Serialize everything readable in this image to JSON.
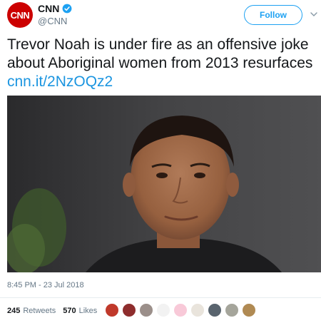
{
  "author": {
    "avatar_text": "CNN",
    "name": "CNN",
    "handle": "@CNN",
    "verified_color": "#1da1f2"
  },
  "actions": {
    "follow_label": "Follow"
  },
  "tweet": {
    "text": "Trevor Noah is under fire as an offensive joke about Aboriginal women from 2013 resurfaces ",
    "link": "cnn.it/2NzOQz2"
  },
  "meta": {
    "timestamp": "8:45 PM - 23 Jul 2018"
  },
  "stats": {
    "retweets_count": "245",
    "retweets_label": "Retweets",
    "likes_count": "570",
    "likes_label": "Likes"
  },
  "likers": {
    "avatar_colors": [
      "#c0392b",
      "#8e2d2d",
      "#9b8f8a",
      "#f2f2f2",
      "#f8c9d8",
      "#e9e4dc",
      "#59646e",
      "#a5a59b",
      "#b08a53"
    ]
  },
  "colors": {
    "link": "#1b95e0",
    "brand_red": "#cc0000"
  },
  "icons": {
    "verified": "verified-badge-icon",
    "chevron": "chevron-down-icon"
  }
}
